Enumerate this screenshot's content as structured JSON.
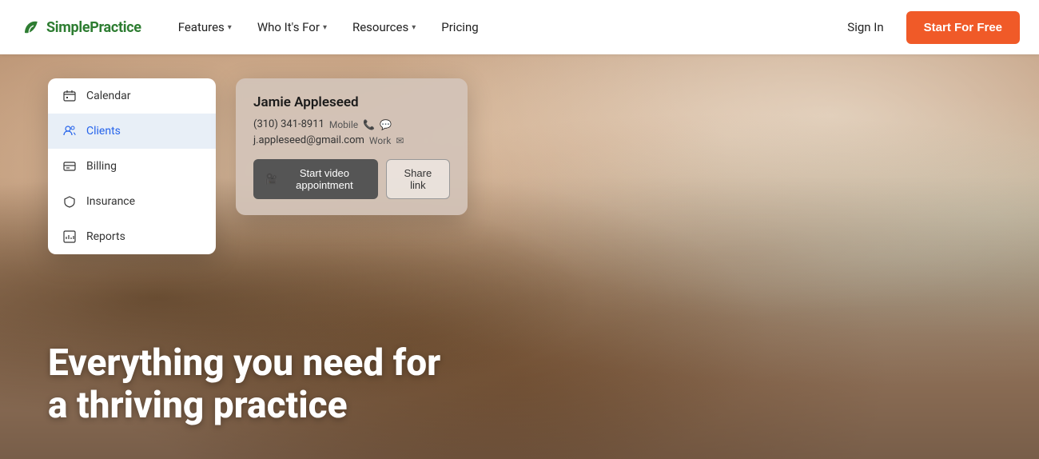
{
  "nav": {
    "logo_text_part1": "Simple",
    "logo_text_part2": "Practice",
    "links": [
      {
        "label": "Features",
        "has_dropdown": true
      },
      {
        "label": "Who It's For",
        "has_dropdown": true
      },
      {
        "label": "Resources",
        "has_dropdown": true
      },
      {
        "label": "Pricing",
        "has_dropdown": false
      }
    ],
    "sign_in_label": "Sign In",
    "cta_label": "Start For Free"
  },
  "sidebar": {
    "items": [
      {
        "label": "Calendar",
        "icon": "calendar",
        "active": false
      },
      {
        "label": "Clients",
        "icon": "clients",
        "active": true
      },
      {
        "label": "Billing",
        "icon": "billing",
        "active": false
      },
      {
        "label": "Insurance",
        "icon": "insurance",
        "active": false
      },
      {
        "label": "Reports",
        "icon": "reports",
        "active": false
      }
    ]
  },
  "client_card": {
    "name": "Jamie Appleseed",
    "phone": "(310) 341-8911",
    "phone_type": "Mobile",
    "email": "j.appleseed@gmail.com",
    "email_type": "Work",
    "btn_video": "Start video appointment",
    "btn_share": "Share link"
  },
  "hero": {
    "headline_line1": "Everything you need for",
    "headline_line2": "a thriving practice"
  }
}
